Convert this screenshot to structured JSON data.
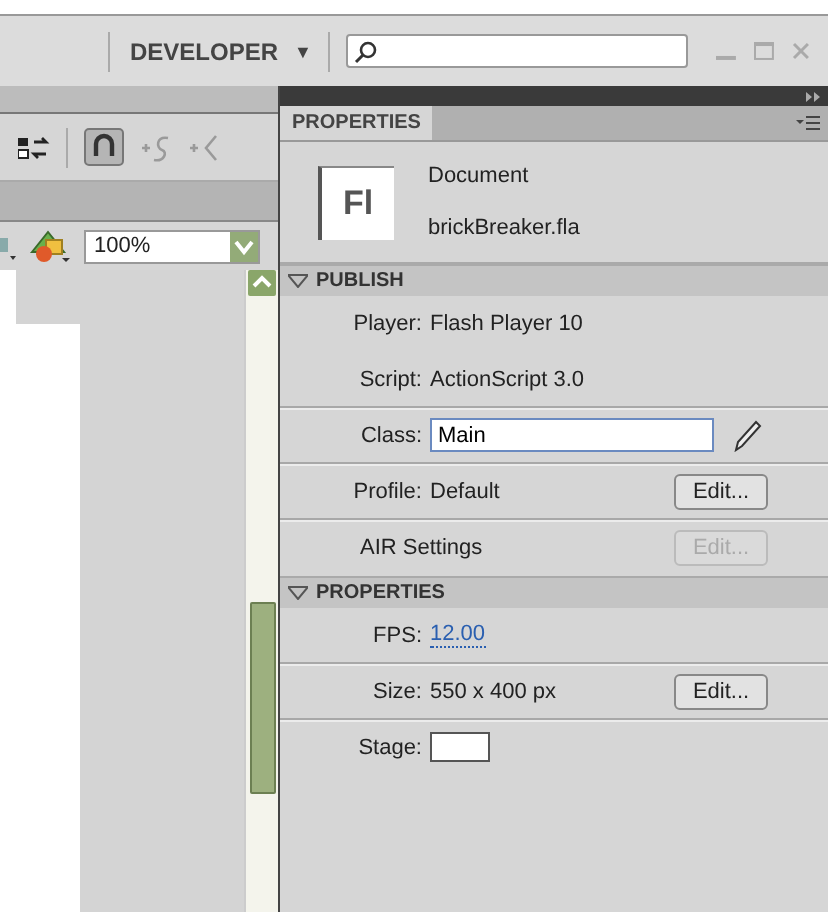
{
  "toolbar": {
    "workspace": "DEVELOPER",
    "workspace_caret": "▼"
  },
  "left_panel": {
    "zoom": "100%"
  },
  "properties_panel": {
    "tab": {
      "label": "PROPERTIES",
      "selected": true
    },
    "document": {
      "icon_text": "Fl",
      "type": "Document",
      "name": "brickBreaker.fla"
    },
    "sections": [
      {
        "title": "PUBLISH",
        "expanded": true,
        "rows": [
          {
            "kind": "text",
            "label": "Player:",
            "value": "Flash Player 10",
            "divider": false
          },
          {
            "kind": "text",
            "label": "Script:",
            "value": "ActionScript 3.0",
            "divider": true
          },
          {
            "kind": "field",
            "label": "Class:",
            "value": "Main",
            "divider": true
          },
          {
            "kind": "text",
            "label": "Profile:",
            "value": "Default",
            "button": {
              "label": "Edit...",
              "disabled": false
            },
            "divider": true
          },
          {
            "kind": "label",
            "label": "AIR Settings",
            "button": {
              "label": "Edit...",
              "disabled": true
            },
            "divider": false
          }
        ]
      },
      {
        "title": "PROPERTIES",
        "expanded": true,
        "rows": [
          {
            "kind": "link",
            "label": "FPS:",
            "value": "12.00",
            "divider": true
          },
          {
            "kind": "text",
            "label": "Size:",
            "value": "550 x 400 px",
            "button": {
              "label": "Edit...",
              "disabled": false
            },
            "divider": true
          },
          {
            "kind": "swatch",
            "label": "Stage:",
            "color": "#ffffff",
            "divider": false
          }
        ]
      }
    ]
  }
}
